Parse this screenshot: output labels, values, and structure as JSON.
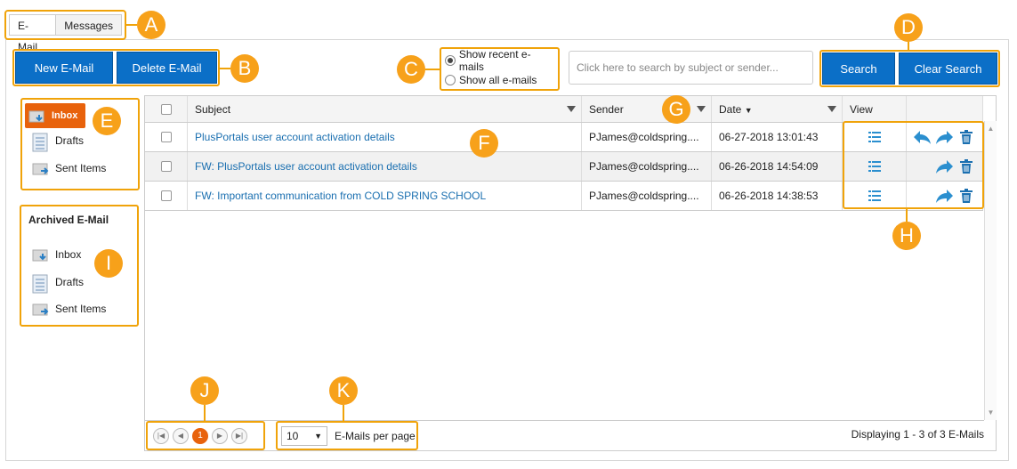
{
  "tabs": [
    {
      "label": "E-Mail"
    },
    {
      "label": "Messages"
    }
  ],
  "toolbar": {
    "new_email": "New E-Mail",
    "delete_email": "Delete E-Mail",
    "search": "Search",
    "clear_search": "Clear Search"
  },
  "filter": {
    "recent": "Show recent e-mails",
    "all": "Show all e-mails",
    "selected": "recent"
  },
  "search": {
    "placeholder": "Click here to search by subject or sender..."
  },
  "folders": {
    "inbox": "Inbox",
    "drafts": "Drafts",
    "sent": "Sent Items",
    "archived_title": "Archived E-Mail",
    "arch_inbox": "Inbox",
    "arch_drafts": "Drafts",
    "arch_sent": "Sent Items"
  },
  "grid": {
    "headers": {
      "subject": "Subject",
      "sender": "Sender",
      "date": "Date",
      "view": "View"
    },
    "rows": [
      {
        "subject": "PlusPortals user account activation details",
        "sender": "PJames@coldspring....",
        "date": "06-27-2018 13:01:43"
      },
      {
        "subject": "FW: PlusPortals user account activation details",
        "sender": "PJames@coldspring....",
        "date": "06-26-2018 14:54:09"
      },
      {
        "subject": "FW: Important communication from COLD SPRING SCHOOL",
        "sender": "PJames@coldspring....",
        "date": "06-26-2018 14:38:53"
      }
    ]
  },
  "pager": {
    "current": "1",
    "per_page": "10",
    "per_page_label": "E-Mails per page",
    "display": "Displaying 1 - 3 of 3 E-Mails"
  },
  "callouts": {
    "a": "A",
    "b": "B",
    "c": "C",
    "d": "D",
    "e": "E",
    "f": "F",
    "g": "G",
    "h": "H",
    "i": "I",
    "j": "J",
    "k": "K"
  },
  "colors": {
    "accent": "#f7a11a",
    "primary": "#0b6fc7",
    "link": "#1a6fb0",
    "active_folder": "#e8620c"
  }
}
